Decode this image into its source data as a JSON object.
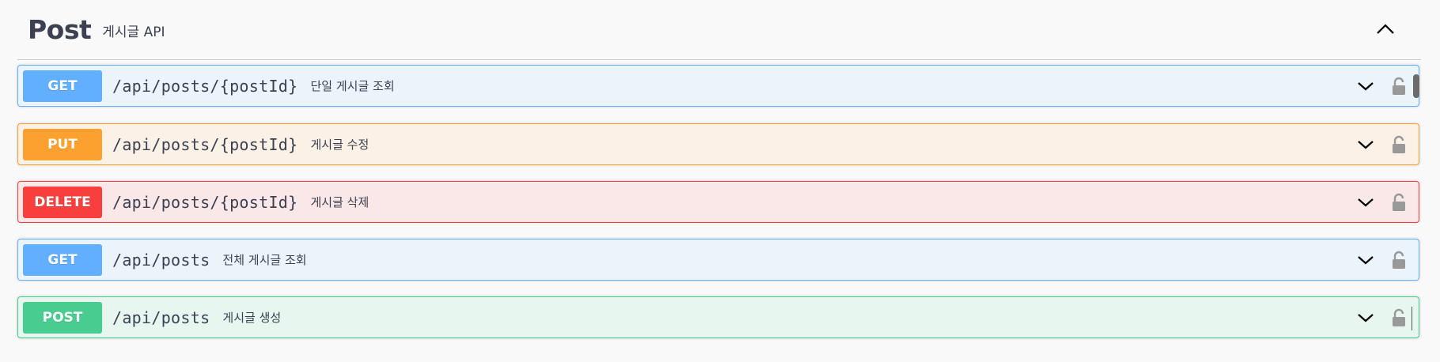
{
  "tag": {
    "title": "Post",
    "description": "게시글 API"
  },
  "operations": [
    {
      "method": "GET",
      "path": "/api/posts/{postId}",
      "summary": "단일 게시글 조회"
    },
    {
      "method": "PUT",
      "path": "/api/posts/{postId}",
      "summary": "게시글 수정"
    },
    {
      "method": "DELETE",
      "path": "/api/posts/{postId}",
      "summary": "게시글 삭제"
    },
    {
      "method": "GET",
      "path": "/api/posts",
      "summary": "전체 게시글 조회"
    },
    {
      "method": "POST",
      "path": "/api/posts",
      "summary": "게시글 생성"
    }
  ],
  "icons": {
    "collapse": "chevron-up-icon",
    "expand": "chevron-down-icon",
    "authorize": "unlocked-lock-icon"
  },
  "colors": {
    "get": "#61affe",
    "put": "#fca130",
    "delete": "#f93e3e",
    "post": "#49cc90"
  }
}
